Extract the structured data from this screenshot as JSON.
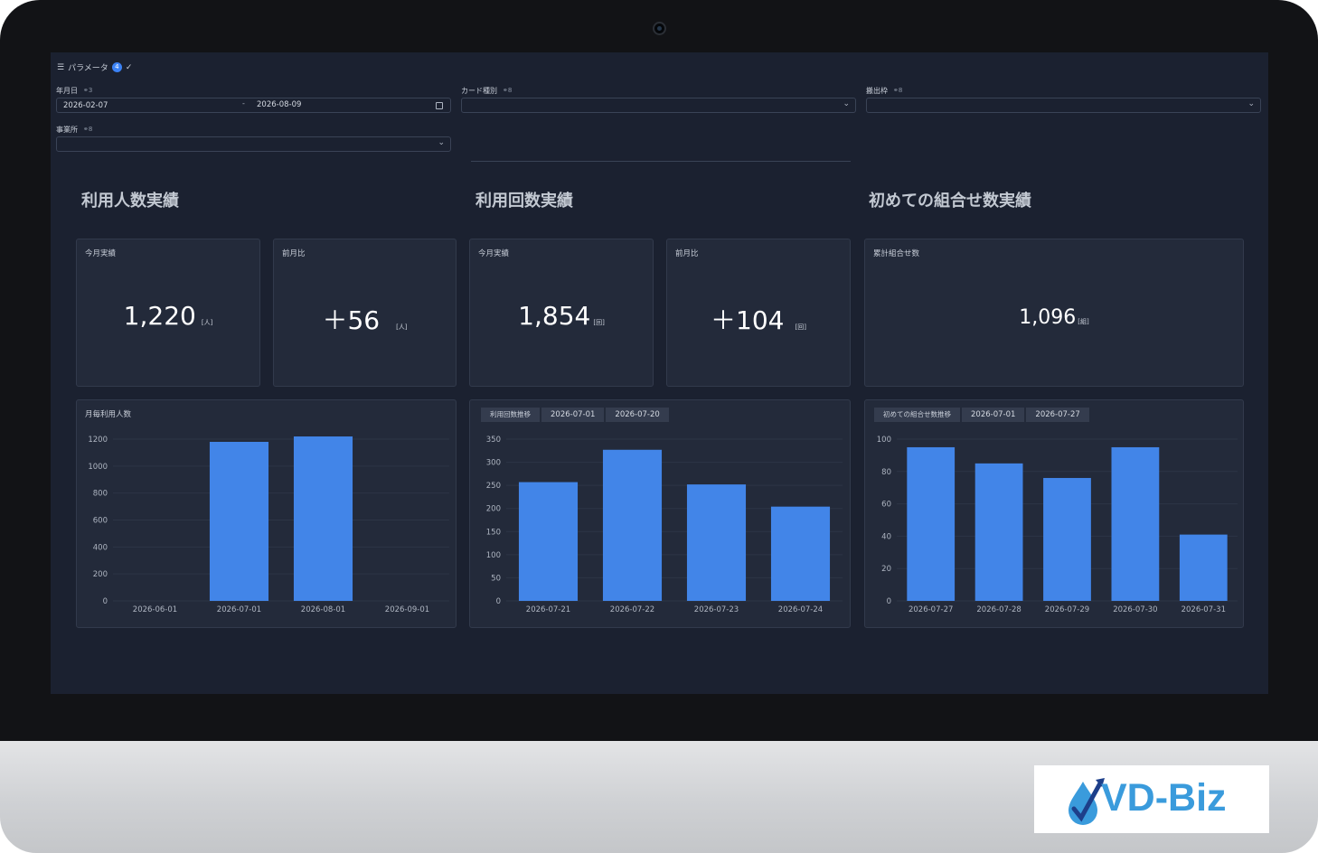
{
  "params": {
    "label": "パラメータ",
    "count": "4"
  },
  "filters": {
    "date": {
      "label": "年月日",
      "links": "3",
      "start": "2026-02-07",
      "separator": "-",
      "end": "2026-08-09"
    },
    "card_type": {
      "label": "カード種別",
      "links": "8",
      "value": ""
    },
    "exit_frame": {
      "label": "搬出枠",
      "links": "8",
      "value": ""
    },
    "office": {
      "label": "事業所",
      "links": "8",
      "value": ""
    }
  },
  "sections": {
    "users": {
      "title": "利用人数実績"
    },
    "uses": {
      "title": "利用回数実績"
    },
    "combos": {
      "title": "初めての組合せ数実績"
    }
  },
  "kpis": {
    "users_month": {
      "label": "今月実績",
      "value": "1,220",
      "unit": "[人]"
    },
    "users_diff": {
      "label": "前月比",
      "value": "＋56",
      "unit": "[人]"
    },
    "uses_month": {
      "label": "今月実績",
      "value": "1,854",
      "unit": "[回]"
    },
    "uses_diff": {
      "label": "前月比",
      "value": "＋104",
      "unit": "[回]"
    },
    "combos_total": {
      "label": "累計組合せ数",
      "value": "1,096",
      "unit": "[組]"
    }
  },
  "chart_data": [
    {
      "type": "bar",
      "title": "月毎利用人数",
      "categories": [
        "2026-06-01",
        "2026-07-01",
        "2026-08-01",
        "2026-09-01"
      ],
      "values": [
        0,
        1180,
        1220,
        0
      ],
      "ylim": [
        0,
        1200
      ],
      "yticks": [
        0,
        200,
        400,
        600,
        800,
        1000,
        1200
      ],
      "grid": true,
      "color": "#4285e8"
    },
    {
      "type": "bar",
      "breadcrumbs": [
        "利用回数推移",
        "2026-07-01",
        "2026-07-20"
      ],
      "categories": [
        "2026-07-21",
        "2026-07-22",
        "2026-07-23",
        "2026-07-24"
      ],
      "values": [
        257,
        327,
        252,
        204
      ],
      "ylim": [
        0,
        350
      ],
      "yticks": [
        0,
        50,
        100,
        150,
        200,
        250,
        300,
        350
      ],
      "grid": true,
      "color": "#4285e8"
    },
    {
      "type": "bar",
      "breadcrumbs": [
        "初めての組合せ数推移",
        "2026-07-01",
        "2026-07-27"
      ],
      "categories": [
        "2026-07-27",
        "2026-07-28",
        "2026-07-29",
        "2026-07-30",
        "2026-07-31"
      ],
      "values": [
        95,
        85,
        76,
        95,
        41
      ],
      "ylim": [
        0,
        100
      ],
      "yticks": [
        0,
        20,
        40,
        60,
        80,
        100
      ],
      "grid": true,
      "color": "#4285e8"
    }
  ],
  "branding": {
    "logo_text": "VD-Biz",
    "logo_color": "#3a9bdc"
  }
}
